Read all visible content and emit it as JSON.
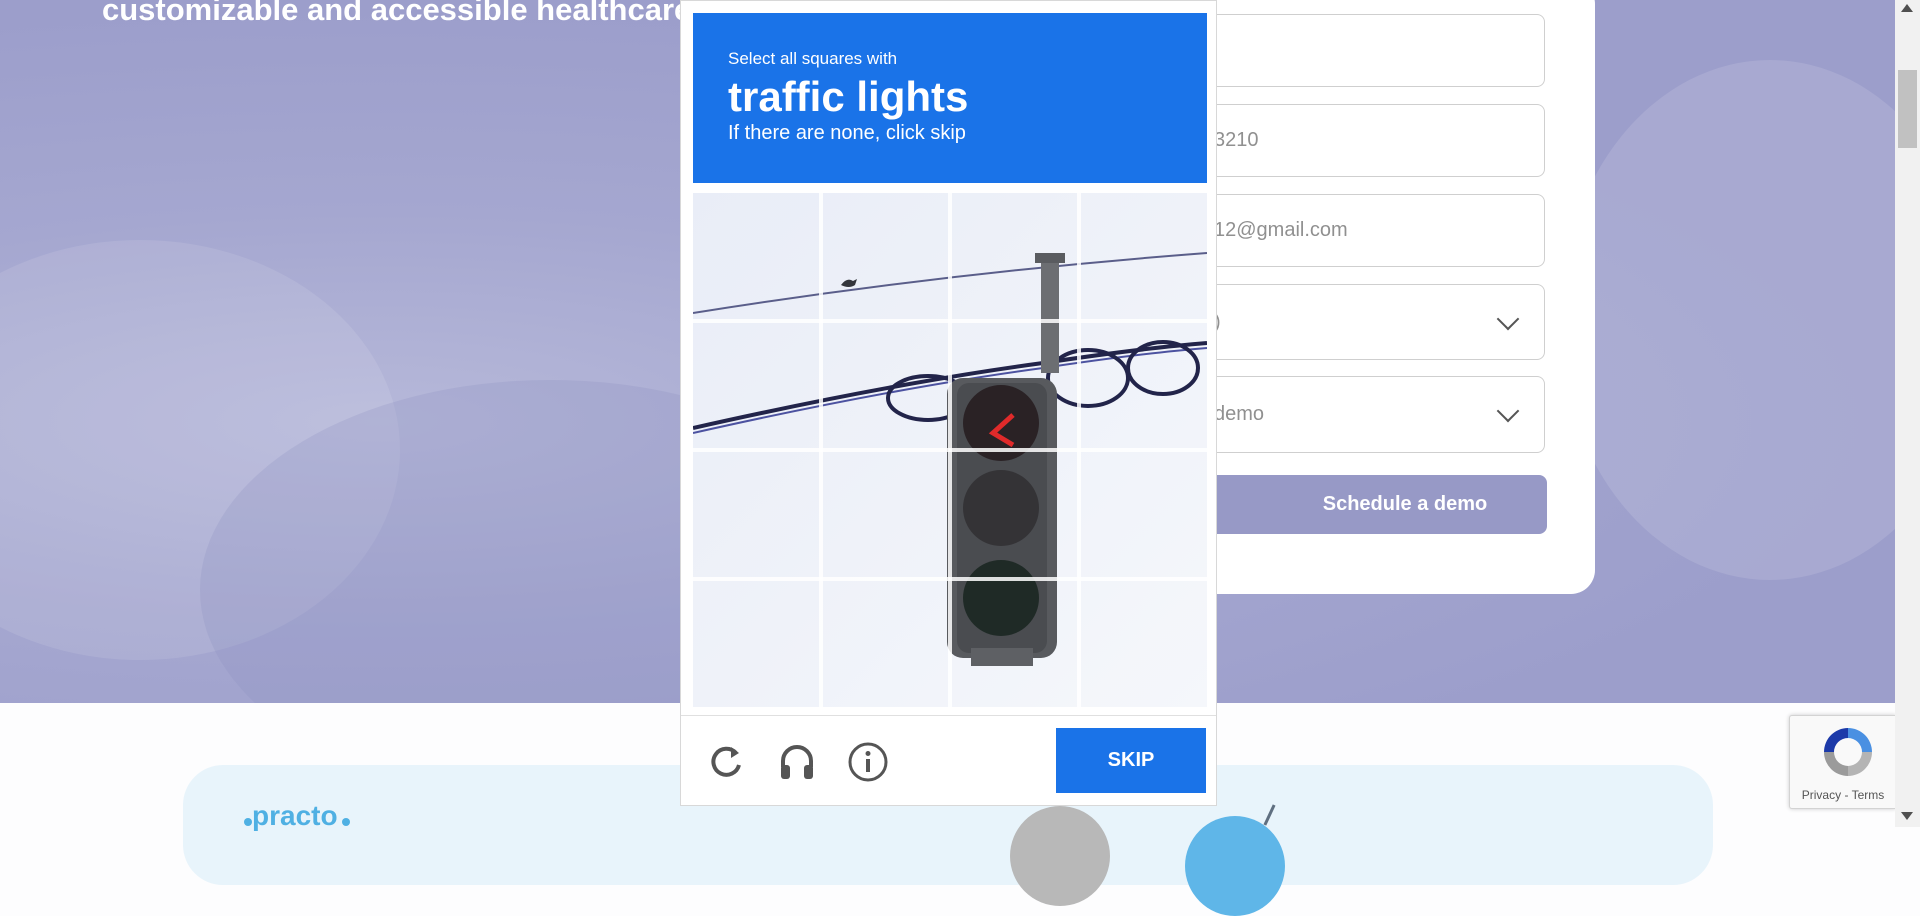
{
  "hero": {
    "title": "customizable and accessible healthcare solu"
  },
  "form": {
    "fields": [
      {
        "name": "name",
        "value": ""
      },
      {
        "name": "phone",
        "value": "3210"
      },
      {
        "name": "email",
        "value": "12@gmail.com"
      },
      {
        "name": "select-1",
        "value": ")"
      },
      {
        "name": "select-2",
        "value": "demo"
      }
    ],
    "submit_label": "Schedule a demo"
  },
  "captcha": {
    "instruction": "Select all squares with",
    "target": "traffic lights",
    "hint": "If there are none, click skip",
    "skip_label": "SKIP",
    "icons": [
      "reload-icon",
      "audio-icon",
      "info-icon"
    ],
    "header_color": "#1a73e8"
  },
  "recaptcha_badge": {
    "privacy_label": "Privacy",
    "separator": "-",
    "terms_label": "Terms"
  },
  "footer": {
    "logo_text": "practo"
  },
  "colors": {
    "hero_bg": "#a1a3cf",
    "button_purple": "#9799c6",
    "captcha_blue": "#1a73e8"
  }
}
